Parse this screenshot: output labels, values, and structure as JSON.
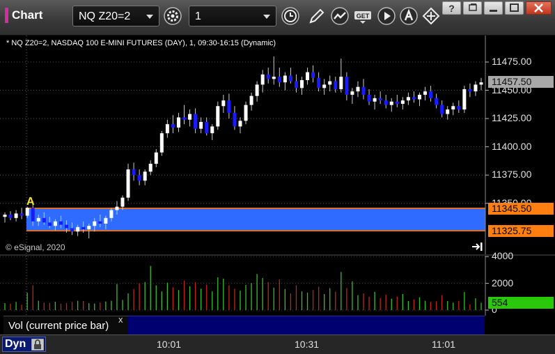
{
  "window": {
    "title": "Chart",
    "accent_color": "#d02fa0"
  },
  "toolbar": {
    "symbol_value": "NQ Z20=2",
    "interval_value": "1",
    "icons": [
      "gear-icon",
      "clock-icon",
      "pencil-icon",
      "study-icon",
      "get-icon",
      "play-icon",
      "a-icon",
      "crosshair-icon"
    ]
  },
  "chart": {
    "info": "* NQ Z20=2, NASDAQ 100 E-MINI FUTURES (DAY), 1, 09:30-16:15 (Dynamic)",
    "copyright": "© eSignal, 2020",
    "marker": "A",
    "bar_up_color": "#ffffff",
    "bar_down_color": "#1a1aff",
    "zone_color": "#2f6bff",
    "zone_border_color": "#e07020",
    "price_tags": {
      "last": {
        "text": "11457.50",
        "bg": "#a8a8a8"
      },
      "zone_high": {
        "text": "11345.50",
        "bg": "#ff8010"
      },
      "zone_low": {
        "text": "11325.75",
        "bg": "#ff8010"
      },
      "volume": {
        "text": "554",
        "bg": "#2ac80a"
      }
    }
  },
  "volume_pane": {
    "legend": "Vol (current price bar)",
    "close_glyph": "x"
  },
  "bottom_bar": {
    "mode": "Dyn"
  },
  "chart_data": {
    "type": "candlestick",
    "y_axis": {
      "ticks": [
        "11475.00",
        "11450.00",
        "11425.00",
        "11400.00",
        "11375.00",
        "11350.00"
      ],
      "range": [
        11315,
        11483
      ]
    },
    "x_axis": {
      "ticks": [
        "10:01",
        "10:31",
        "11:01"
      ]
    },
    "zone": {
      "high": 11345.5,
      "low": 11325.75
    },
    "last_price": 11457.5,
    "candles": [
      [
        11338,
        11342,
        11333,
        11340
      ],
      [
        11340,
        11343,
        11335,
        11337
      ],
      [
        11337,
        11344,
        11334,
        11341
      ],
      [
        11341,
        11346,
        11336,
        11339
      ],
      [
        11339,
        11347,
        11337,
        11346
      ],
      [
        11346,
        11352,
        11330,
        11334
      ],
      [
        11334,
        11340,
        11330,
        11337
      ],
      [
        11337,
        11342,
        11331,
        11333
      ],
      [
        11333,
        11338,
        11328,
        11330
      ],
      [
        11330,
        11336,
        11326,
        11334
      ],
      [
        11334,
        11339,
        11328,
        11331
      ],
      [
        11331,
        11335,
        11324,
        11328
      ],
      [
        11328,
        11333,
        11322,
        11325
      ],
      [
        11325,
        11331,
        11321,
        11329
      ],
      [
        11329,
        11334,
        11324,
        11327
      ],
      [
        11327,
        11332,
        11319,
        11330
      ],
      [
        11330,
        11337,
        11325,
        11334
      ],
      [
        11334,
        11340,
        11329,
        11332
      ],
      [
        11332,
        11339,
        11327,
        11337
      ],
      [
        11337,
        11346,
        11334,
        11344
      ],
      [
        11344,
        11352,
        11340,
        11347
      ],
      [
        11347,
        11357,
        11344,
        11355
      ],
      [
        11355,
        11385,
        11352,
        11380
      ],
      [
        11380,
        11386,
        11370,
        11375
      ],
      [
        11375,
        11380,
        11366,
        11370
      ],
      [
        11370,
        11380,
        11366,
        11378
      ],
      [
        11378,
        11388,
        11375,
        11385
      ],
      [
        11385,
        11398,
        11382,
        11395
      ],
      [
        11395,
        11414,
        11392,
        11412
      ],
      [
        11412,
        11424,
        11408,
        11420
      ],
      [
        11420,
        11428,
        11412,
        11417
      ],
      [
        11417,
        11430,
        11413,
        11426
      ],
      [
        11426,
        11437,
        11420,
        11424
      ],
      [
        11424,
        11433,
        11418,
        11429
      ],
      [
        11429,
        11434,
        11412,
        11416
      ],
      [
        11416,
        11426,
        11412,
        11422
      ],
      [
        11422,
        11426,
        11410,
        11412
      ],
      [
        11412,
        11420,
        11406,
        11418
      ],
      [
        11418,
        11440,
        11415,
        11436
      ],
      [
        11436,
        11446,
        11430,
        11441
      ],
      [
        11441,
        11447,
        11425,
        11430
      ],
      [
        11430,
        11436,
        11415,
        11418
      ],
      [
        11418,
        11426,
        11412,
        11423
      ],
      [
        11423,
        11440,
        11420,
        11437
      ],
      [
        11437,
        11448,
        11432,
        11445
      ],
      [
        11445,
        11458,
        11440,
        11455
      ],
      [
        11455,
        11468,
        11448,
        11464
      ],
      [
        11464,
        11470,
        11456,
        11460
      ],
      [
        11460,
        11480,
        11455,
        11462
      ],
      [
        11462,
        11470,
        11453,
        11457
      ],
      [
        11457,
        11466,
        11450,
        11463
      ],
      [
        11463,
        11470,
        11456,
        11458
      ],
      [
        11458,
        11464,
        11448,
        11452
      ],
      [
        11452,
        11462,
        11446,
        11459
      ],
      [
        11459,
        11470,
        11455,
        11466
      ],
      [
        11466,
        11472,
        11457,
        11461
      ],
      [
        11461,
        11466,
        11449,
        11452
      ],
      [
        11452,
        11460,
        11446,
        11455
      ],
      [
        11455,
        11463,
        11449,
        11458
      ],
      [
        11458,
        11462,
        11448,
        11451
      ],
      [
        11451,
        11478,
        11448,
        11462
      ],
      [
        11462,
        11466,
        11441,
        11446
      ],
      [
        11446,
        11452,
        11438,
        11449
      ],
      [
        11449,
        11458,
        11444,
        11453
      ],
      [
        11453,
        11460,
        11442,
        11446
      ],
      [
        11446,
        11451,
        11437,
        11440
      ],
      [
        11440,
        11446,
        11433,
        11443
      ],
      [
        11443,
        11449,
        11438,
        11441
      ],
      [
        11441,
        11446,
        11434,
        11437
      ],
      [
        11437,
        11443,
        11431,
        11440
      ],
      [
        11440,
        11446,
        11435,
        11438
      ],
      [
        11438,
        11444,
        11433,
        11441
      ],
      [
        11441,
        11448,
        11437,
        11444
      ],
      [
        11444,
        11449,
        11439,
        11442
      ],
      [
        11442,
        11448,
        11436,
        11446
      ],
      [
        11446,
        11453,
        11441,
        11449
      ],
      [
        11449,
        11454,
        11440,
        11443
      ],
      [
        11443,
        11447,
        11434,
        11437
      ],
      [
        11437,
        11441,
        11426,
        11429
      ],
      [
        11429,
        11436,
        11424,
        11433
      ],
      [
        11433,
        11439,
        11428,
        11436
      ],
      [
        11436,
        11441,
        11430,
        11433
      ],
      [
        11433,
        11454,
        11430,
        11451
      ],
      [
        11451,
        11456,
        11444,
        11449
      ],
      [
        11449,
        11458,
        11445,
        11455
      ],
      [
        11455,
        11461,
        11450,
        11457
      ]
    ],
    "volume_axis": {
      "ticks": [
        "4000",
        "2000",
        "0"
      ],
      "range": [
        0,
        4000
      ]
    },
    "volumes": [
      520,
      480,
      610,
      400,
      1300,
      1850,
      700,
      560,
      540,
      620,
      480,
      530,
      610,
      700,
      680,
      520,
      490,
      580,
      640,
      700,
      1950,
      760,
      1250,
      1580,
      1980,
      2100,
      3300,
      1850,
      1400,
      2050,
      1700,
      1500,
      2200,
      1780,
      2080,
      1600,
      1900,
      1400,
      2450,
      2350,
      1850,
      1600,
      1450,
      1880,
      2020,
      2700,
      2400,
      2100,
      1680,
      2300,
      1580,
      1250,
      1850,
      1400,
      1300,
      1500,
      1750,
      1200,
      1640,
      1380,
      2850,
      1650,
      2150,
      1120,
      1250,
      1000,
      1360,
      900,
      1150,
      850,
      1000,
      1200,
      680,
      790,
      960,
      700,
      620,
      650,
      1120,
      680,
      560,
      690,
      1350,
      420,
      880,
      554
    ]
  }
}
